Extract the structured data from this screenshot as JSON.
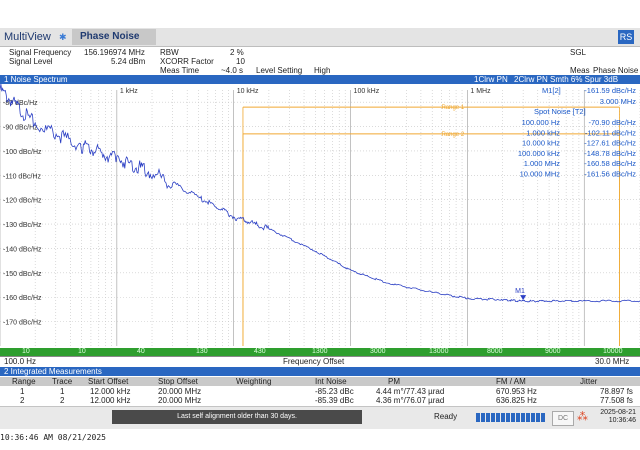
{
  "app": {
    "title": "MultiView",
    "star": "✱",
    "active_tab": "Phase Noise",
    "rs_icon": "RS"
  },
  "header": {
    "signal_frequency_label": "Signal Frequency",
    "signal_frequency_value": "156.196974 MHz",
    "signal_level_label": "Signal Level",
    "signal_level_value": "5.24 dBm",
    "rbw_label": "RBW",
    "rbw_value": "2 %",
    "xcorr_label": "XCORR Factor",
    "xcorr_value": "10",
    "meas_time_label": "Meas Time",
    "meas_time_value": "~4.0 s",
    "level_setting_label": "Level Setting",
    "level_setting_value": "High",
    "sgl": "SGL",
    "meas_label": "Meas",
    "meas_value": "Phase Noise"
  },
  "trace_window": {
    "title": "1 Noise Spectrum",
    "trace1": "1Clrw PN",
    "trace2": "2Clrw PN Smth 6% Spur 3dB"
  },
  "marker": {
    "label": "M1[2]",
    "value": "-161.59 dBc/Hz",
    "freq": "3.000 MHz",
    "plot_label": "M1"
  },
  "spot_noise": {
    "title": "Spot Noise [T2]",
    "rows": [
      {
        "freq": "100.000 Hz",
        "value": "-70.90 dBc/Hz"
      },
      {
        "freq": "1.000 kHz",
        "value": "-102.11 dBc/Hz"
      },
      {
        "freq": "10.000 kHz",
        "value": "-127.61 dBc/Hz"
      },
      {
        "freq": "100.000 kHz",
        "value": "-148.78 dBc/Hz"
      },
      {
        "freq": "1.000 MHz",
        "value": "-160.58 dBc/Hz"
      },
      {
        "freq": "10.000 MHz",
        "value": "-161.56 dBc/Hz"
      }
    ]
  },
  "chart_data": {
    "type": "line",
    "x_scale": "log",
    "xlim": [
      "100.0 Hz",
      "30.0 MHz"
    ],
    "x_start_label": "100.0 Hz",
    "x_end_label": "30.0 MHz",
    "xlabel": "Frequency Offset",
    "x_ticks": [
      "1 kHz",
      "10 kHz",
      "100 kHz",
      "1 MHz"
    ],
    "ylim": [
      -180,
      -75
    ],
    "y_ticks": [
      "-80 dBc/Hz",
      "-90 dBc/Hz",
      "-100 dBc/Hz",
      "-110 dBc/Hz",
      "-120 dBc/Hz",
      "-130 dBc/Hz",
      "-140 dBc/Hz",
      "-150 dBc/Hz",
      "-160 dBc/Hz",
      "-170 dBc/Hz"
    ],
    "xcorr_counts": [
      "10",
      "10",
      "40",
      "130",
      "430",
      "1300",
      "3000",
      "13000",
      "8000",
      "9000",
      "10000"
    ],
    "grid": true,
    "series": [
      {
        "name": "2Clrw PN Smth 6% Spur 3dB",
        "color": "#2b3fc4",
        "x_hz": [
          100,
          200,
          500,
          1000,
          2000,
          5000,
          10000,
          20000,
          50000,
          100000,
          200000,
          500000,
          1000000,
          2000000,
          3000000,
          5000000,
          10000000,
          30000000
        ],
        "y": [
          -75,
          -89,
          -98,
          -103,
          -109,
          -119,
          -127,
          -132,
          -141,
          -149,
          -154,
          -158,
          -160.5,
          -161,
          -161.6,
          -161.5,
          -161.6,
          -161.5
        ]
      }
    ],
    "integration_range_labels": [
      "Range 1",
      "Range 2"
    ],
    "integration_range_colors": [
      "#f0a830",
      "#f0a830"
    ],
    "integration_ranges": [
      {
        "x_hz": [
          12000,
          20000000
        ],
        "y": -82
      },
      {
        "x_hz": [
          12000,
          20000000
        ],
        "y": -93
      }
    ]
  },
  "integrated": {
    "title": "2 Integrated Measurements",
    "headers": [
      "Range",
      "Trace",
      "Start Offset",
      "Stop Offset",
      "Weighting",
      "Int Noise",
      "PM",
      "FM / AM",
      "Jitter"
    ],
    "rows": [
      [
        "1",
        "1",
        "12.000 kHz",
        "20.000 MHz",
        "",
        "-85.23 dBc",
        "4.44 m°/77.43 µrad",
        "670.953 Hz",
        "78.897 fs"
      ],
      [
        "2",
        "2",
        "12.000 kHz",
        "20.000 MHz",
        "",
        "-85.39 dBc",
        "4.36 m°/76.07 µrad",
        "636.825 Hz",
        "77.508 fs"
      ]
    ]
  },
  "status": {
    "message": "Last self alignment older than 30 days.",
    "ready": "Ready",
    "dc": "DC",
    "date": "2025-08-21",
    "time": "10:36:46"
  },
  "clock": "10:36:46 AM  08/21/2025"
}
